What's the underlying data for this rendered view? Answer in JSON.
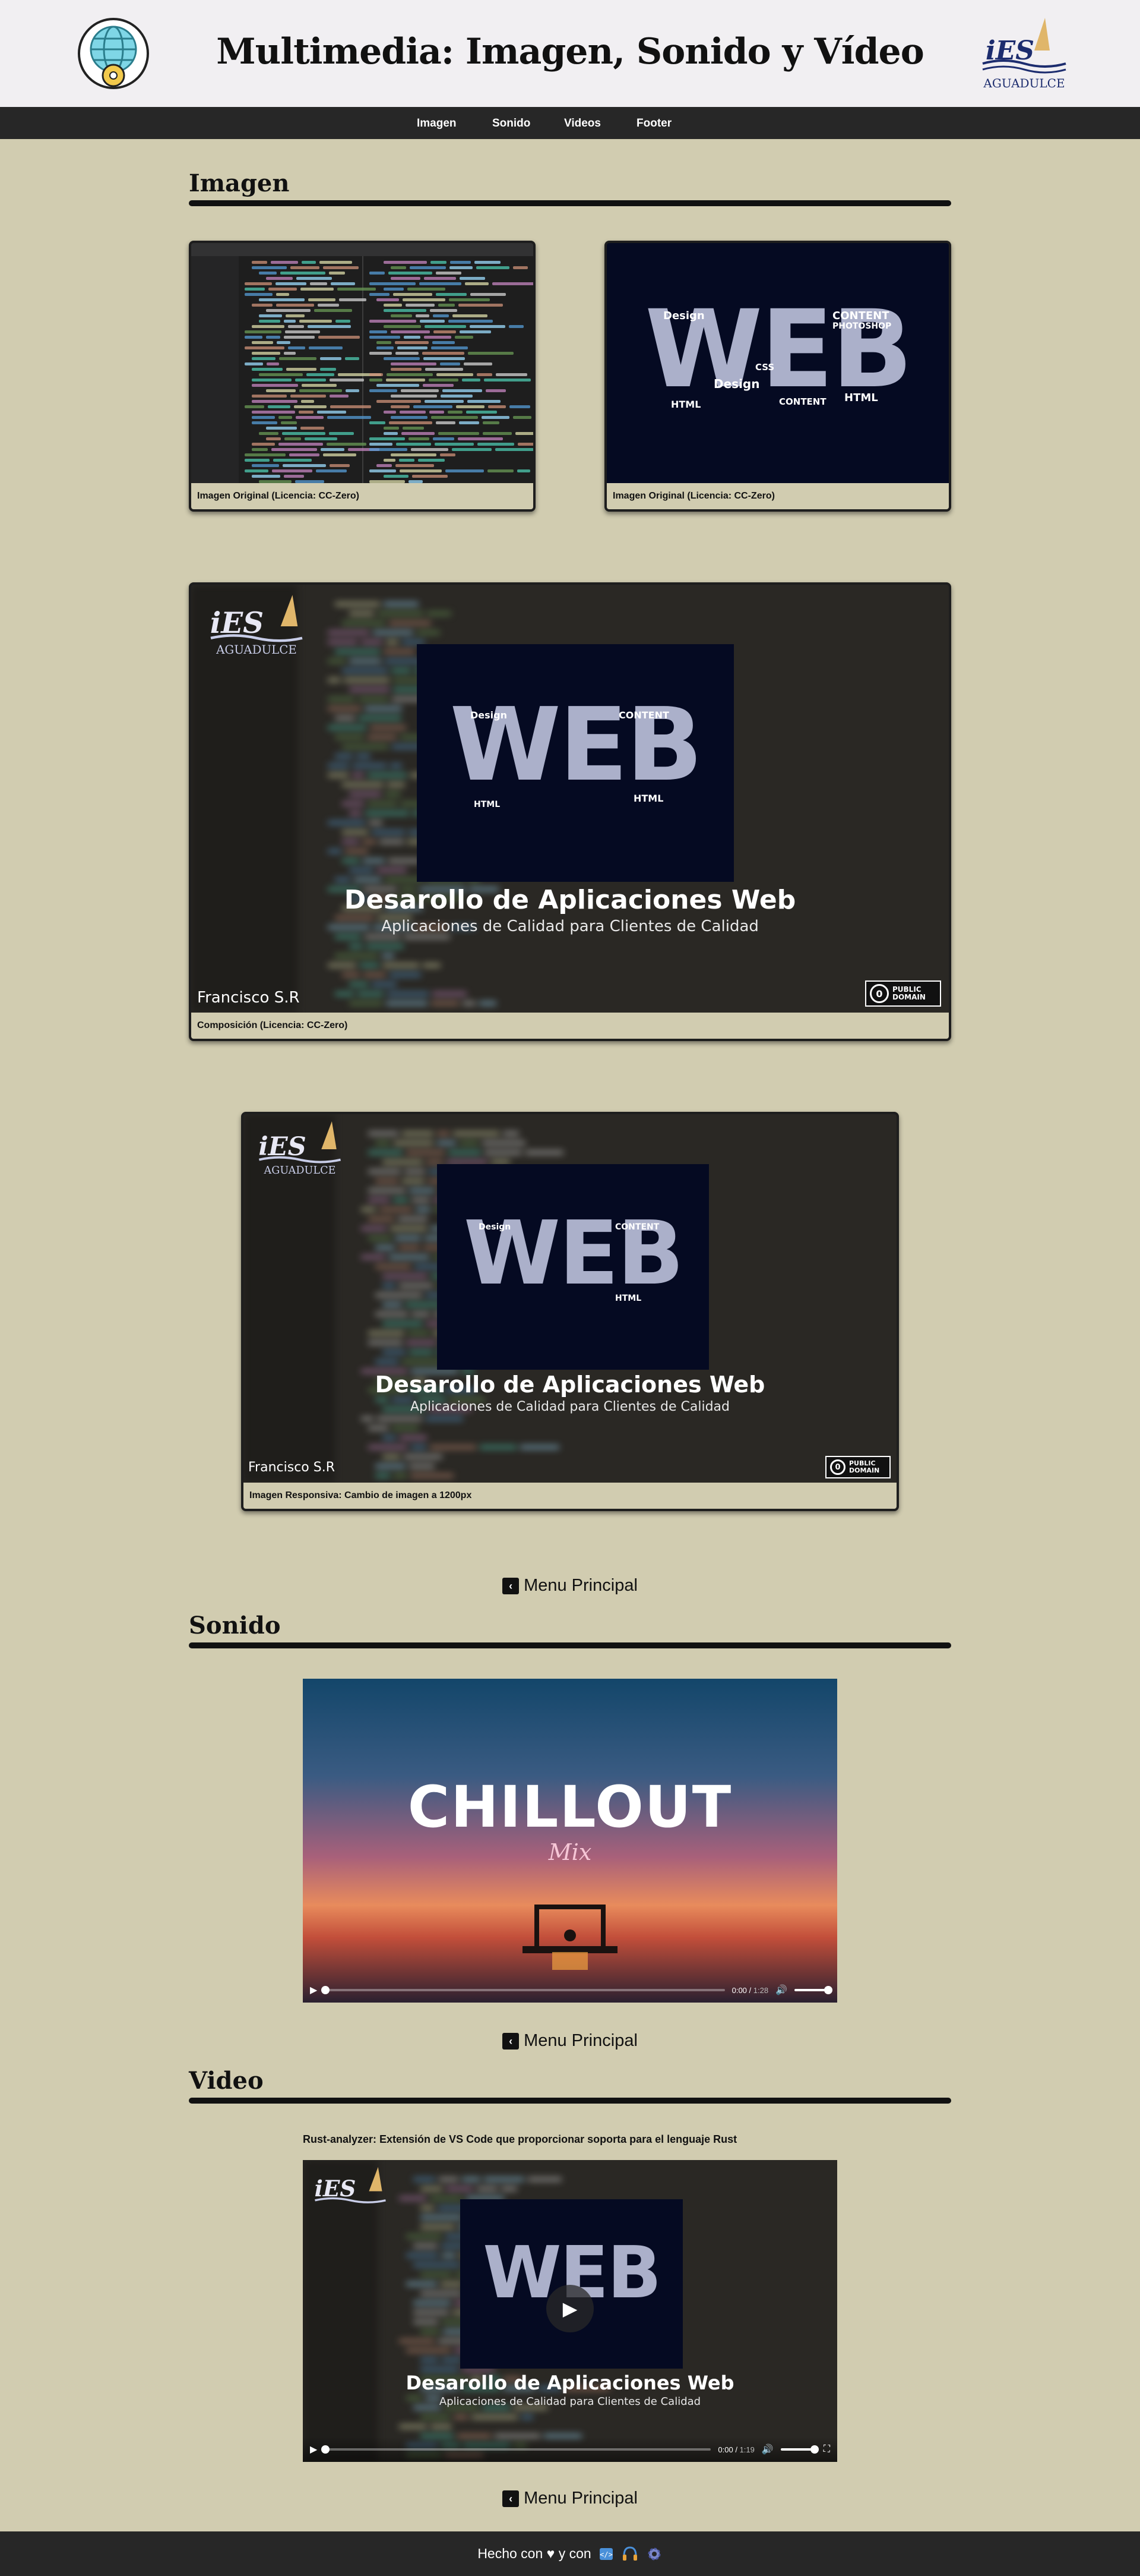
{
  "header": {
    "title": "Multimedia: Imagen, Sonido y Vídeo",
    "left_logo": "globe-gear-logo",
    "right_logo": {
      "brand": "iES",
      "subtitle": "AGUADULCE"
    }
  },
  "nav": {
    "items": [
      {
        "label": "Imagen"
      },
      {
        "label": "Sonido"
      },
      {
        "label": "Videos"
      },
      {
        "label": "Footer"
      }
    ]
  },
  "imagen": {
    "heading": "Imagen",
    "figures": [
      {
        "caption": "Imagen Original (Licencia: CC-Zero)",
        "content": "code-editor-screenshot"
      },
      {
        "caption": "Imagen Original (Licencia: CC-Zero)",
        "content": "web-word-cloud"
      },
      {
        "caption": "Composición (Licencia: CC-Zero)",
        "content": "composition"
      },
      {
        "caption": "Imagen Responsiva: Cambio de imagen a 1200px",
        "content": "composition"
      }
    ],
    "cloud_word": "WEB",
    "cloud_words": [
      "Design",
      "CONTENT",
      "PHOTOSHOP",
      "HTML",
      "CSS",
      "Design",
      "CONTENT",
      "HTML"
    ],
    "composition": {
      "title": "Desarollo de Aplicaciones Web",
      "subtitle": "Aplicaciones de Calidad para Clientes de Calidad",
      "author": "Francisco S.R",
      "badge_line1": "PUBLIC",
      "badge_line2": "DOMAIN",
      "badge_symbol": "0"
    }
  },
  "menu_label": "Menu Principal",
  "sonido": {
    "heading": "Sonido",
    "cover_title": "CHILLOUT",
    "cover_subtitle": "Mix",
    "current_time": "0:00",
    "duration": "1:28",
    "progress": 0
  },
  "video": {
    "heading": "Video",
    "title": "Rust-analyzer: Extensión de VS Code que proporcionar soporta para el lenguaje Rust",
    "current_time": "0:00",
    "duration": "1:19",
    "progress": 0
  },
  "footer": {
    "text": "Hecho con ♥ y con",
    "icons": [
      "code-icon",
      "headphones-icon",
      "gear-icon"
    ]
  },
  "colors": {
    "background": "#d1ccb0",
    "header_bg": "#f1eff2",
    "nav_bg": "#272727",
    "footer_bg": "#272727"
  }
}
